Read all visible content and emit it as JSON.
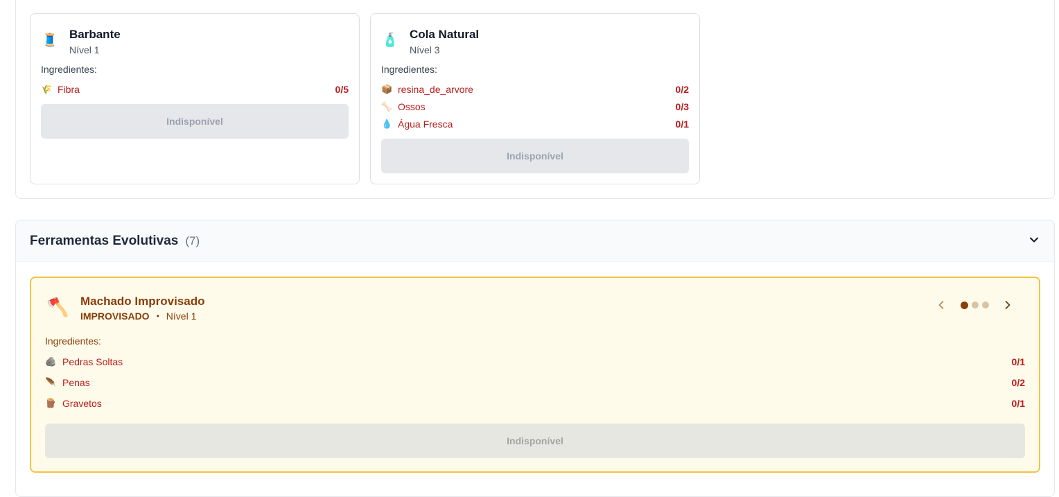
{
  "recipes": [
    {
      "icon": "🧵",
      "title": "Barbante",
      "level": "Nível 1",
      "ingredients_label": "Ingredientes:",
      "ingredients": [
        {
          "icon": "🌾",
          "name": "Fibra",
          "count": "0/5"
        }
      ],
      "button": "Indisponível"
    },
    {
      "icon": "🧴",
      "title": "Cola Natural",
      "level": "Nível 3",
      "ingredients_label": "Ingredientes:",
      "ingredients": [
        {
          "icon": "📦",
          "name": "resina_de_arvore",
          "count": "0/2"
        },
        {
          "icon": "🦴",
          "name": "Ossos",
          "count": "0/3"
        },
        {
          "icon": "💧",
          "name": "Água Fresca",
          "count": "0/1"
        }
      ],
      "button": "Indisponível"
    }
  ],
  "tools": {
    "title": "Ferramentas Evolutivas",
    "count": "(7)",
    "card": {
      "icon": "🪓",
      "title": "Machado Improvisado",
      "type": "IMPROVISADO",
      "separator": "•",
      "level": "Nível 1",
      "ingredients_label": "Ingredientes:",
      "ingredients": [
        {
          "icon": "🪨",
          "name": "Pedras Soltas",
          "count": "0/1"
        },
        {
          "icon": "🪶",
          "name": "Penas",
          "count": "0/2"
        },
        {
          "icon": "🪵",
          "name": "Gravetos",
          "count": "0/1"
        }
      ],
      "button": "Indisponível",
      "pager": {
        "total": 3,
        "active": 0
      }
    }
  },
  "colors": {
    "missing": "#b91c1c",
    "evo_accent": "#8a3d0b",
    "evo_border": "#f5c242",
    "evo_bg": "#fefbea"
  },
  "icons": {
    "chevron_down": "chevron-down-icon",
    "chevron_left": "chevron-left-icon",
    "chevron_right": "chevron-right-icon"
  }
}
